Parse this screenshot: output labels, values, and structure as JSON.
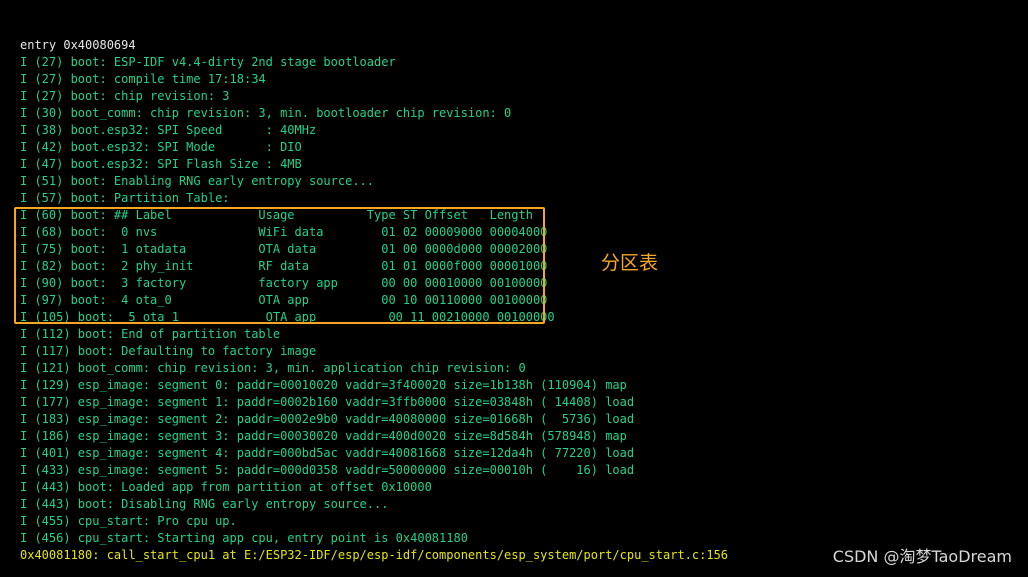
{
  "terminal": {
    "lines": [
      {
        "text": "entry 0x40080694",
        "color": "white"
      },
      {
        "text": "I (27) boot: ESP-IDF v4.4-dirty 2nd stage bootloader",
        "color": "green"
      },
      {
        "text": "I (27) boot: compile time 17:18:34",
        "color": "green"
      },
      {
        "text": "I (27) boot: chip revision: 3",
        "color": "green"
      },
      {
        "text": "I (30) boot_comm: chip revision: 3, min. bootloader chip revision: 0",
        "color": "green"
      },
      {
        "text": "I (38) boot.esp32: SPI Speed      : 40MHz",
        "color": "green"
      },
      {
        "text": "I (42) boot.esp32: SPI Mode       : DIO",
        "color": "green"
      },
      {
        "text": "I (47) boot.esp32: SPI Flash Size : 4MB",
        "color": "green"
      },
      {
        "text": "I (51) boot: Enabling RNG early entropy source...",
        "color": "green"
      },
      {
        "text": "I (57) boot: Partition Table:",
        "color": "green"
      },
      {
        "text": "I (60) boot: ## Label            Usage          Type ST Offset   Length",
        "color": "green"
      },
      {
        "text": "I (68) boot:  0 nvs              WiFi data        01 02 00009000 00004000",
        "color": "green"
      },
      {
        "text": "I (75) boot:  1 otadata          OTA data         01 00 0000d000 00002000",
        "color": "green"
      },
      {
        "text": "I (82) boot:  2 phy_init         RF data          01 01 0000f000 00001000",
        "color": "green"
      },
      {
        "text": "I (90) boot:  3 factory          factory app      00 00 00010000 00100000",
        "color": "green"
      },
      {
        "text": "I (97) boot:  4 ota_0            OTA app          00 10 00110000 00100000",
        "color": "green"
      },
      {
        "text": "I (105) boot:  5 ota_1            OTA app          00 11 00210000 00100000",
        "color": "green"
      },
      {
        "text": "I (112) boot: End of partition table",
        "color": "green"
      },
      {
        "text": "I (117) boot: Defaulting to factory image",
        "color": "green"
      },
      {
        "text": "I (121) boot_comm: chip revision: 3, min. application chip revision: 0",
        "color": "green"
      },
      {
        "text": "I (129) esp_image: segment 0: paddr=00010020 vaddr=3f400020 size=1b138h (110904) map",
        "color": "green"
      },
      {
        "text": "I (177) esp_image: segment 1: paddr=0002b160 vaddr=3ffb0000 size=03848h ( 14408) load",
        "color": "green"
      },
      {
        "text": "I (183) esp_image: segment 2: paddr=0002e9b0 vaddr=40080000 size=01668h (  5736) load",
        "color": "green"
      },
      {
        "text": "I (186) esp_image: segment 3: paddr=00030020 vaddr=400d0020 size=8d584h (578948) map",
        "color": "green"
      },
      {
        "text": "I (401) esp_image: segment 4: paddr=000bd5ac vaddr=40081668 size=12da4h ( 77220) load",
        "color": "green"
      },
      {
        "text": "I (433) esp_image: segment 5: paddr=000d0358 vaddr=50000000 size=00010h (    16) load",
        "color": "green"
      },
      {
        "text": "I (443) boot: Loaded app from partition at offset 0x10000",
        "color": "green"
      },
      {
        "text": "I (443) boot: Disabling RNG early entropy source...",
        "color": "green"
      },
      {
        "text": "I (455) cpu_start: Pro cpu up.",
        "color": "green"
      },
      {
        "text": "I (456) cpu_start: Starting app cpu, entry point is 0x40081180",
        "color": "green"
      },
      {
        "text": "0x40081180: call_start_cpu1 at E:/ESP32-IDF/esp/esp-idf/components/esp_system/port/cpu_start.c:156",
        "color": "yellow"
      }
    ]
  },
  "annotation": {
    "label": "分区表",
    "color": "#f5a623"
  },
  "watermark": {
    "text": "CSDN @淘梦TaoDream"
  },
  "colors": {
    "background": "#000000",
    "log_green": "#23d18b",
    "log_white": "#e6e6e6",
    "log_yellow": "#e5e510",
    "highlight": "#f5a623"
  }
}
